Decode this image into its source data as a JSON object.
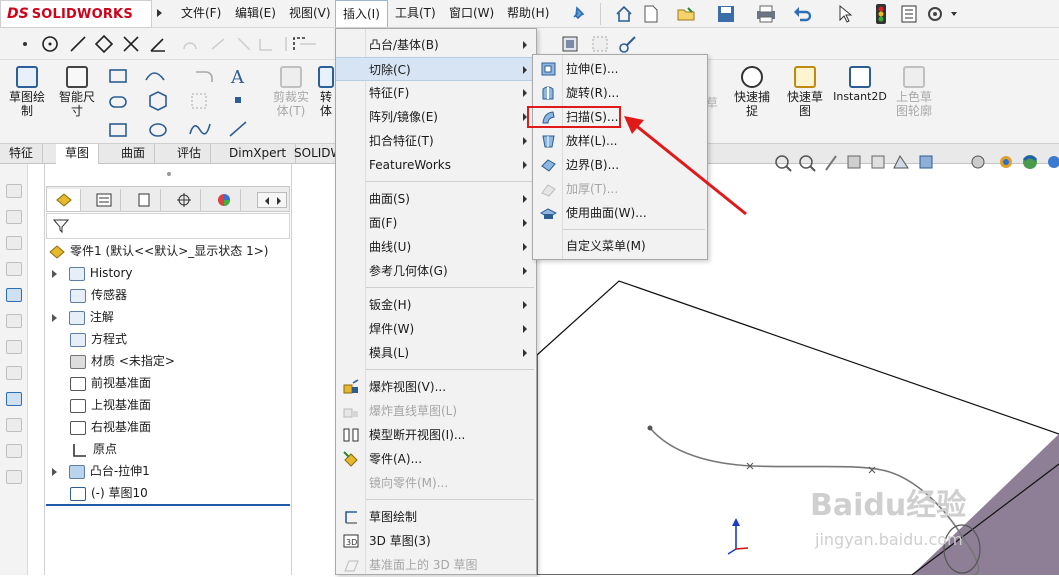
{
  "app": {
    "brand_ds": "DS",
    "brand_name": "SOLIDWORKS"
  },
  "menubar": [
    {
      "label": "文件(F)"
    },
    {
      "label": "编辑(E)"
    },
    {
      "label": "视图(V)"
    },
    {
      "label": "插入(I)"
    },
    {
      "label": "工具(T)"
    },
    {
      "label": "窗口(W)"
    },
    {
      "label": "帮助(H)"
    }
  ],
  "command_manager": {
    "buttons": [
      {
        "label1": "草图绘",
        "label2": "制"
      },
      {
        "label1": "智能尺",
        "label2": "寸"
      },
      {
        "label1": "剪裁实",
        "label2": "体(T)"
      },
      {
        "label1": "转",
        "label2": "体"
      },
      {
        "label1": "快速捕",
        "label2": "捉"
      },
      {
        "label1": "快速草",
        "label2": "图"
      },
      {
        "label1": "Instant2D",
        "label2": ""
      },
      {
        "label1": "上色草",
        "label2": "图轮廓"
      }
    ],
    "behind_label": "草"
  },
  "tabs": [
    "特征",
    "草图",
    "曲面",
    "评估",
    "DimXpert",
    "SOLIDW"
  ],
  "tree": {
    "root": "零件1 (默认<<默认>_显示状态 1>)",
    "items": [
      {
        "label": "History",
        "expandable": true
      },
      {
        "label": "传感器",
        "expandable": false
      },
      {
        "label": "注解",
        "expandable": true
      },
      {
        "label": "方程式",
        "expandable": false
      },
      {
        "label": "材质 <未指定>",
        "expandable": false
      },
      {
        "label": "前视基准面",
        "expandable": false
      },
      {
        "label": "上视基准面",
        "expandable": false
      },
      {
        "label": "右视基准面",
        "expandable": false
      },
      {
        "label": "原点",
        "expandable": false
      },
      {
        "label": "凸台-拉伸1",
        "expandable": true
      },
      {
        "label": "(-) 草图10",
        "expandable": false
      }
    ]
  },
  "insert_menu": {
    "items": [
      {
        "label": "凸台/基体(B)",
        "submenu": true
      },
      {
        "label": "切除(C)",
        "submenu": true,
        "highlighted": true
      },
      {
        "label": "特征(F)",
        "submenu": true
      },
      {
        "label": "阵列/镜像(E)",
        "submenu": true
      },
      {
        "label": "扣合特征(T)",
        "submenu": true
      },
      {
        "label": "FeatureWorks",
        "submenu": true
      },
      {
        "label": "曲面(S)",
        "submenu": true
      },
      {
        "label": "面(F)",
        "submenu": true
      },
      {
        "label": "曲线(U)",
        "submenu": true
      },
      {
        "label": "参考几何体(G)",
        "submenu": true
      },
      {
        "label": "钣金(H)",
        "submenu": true
      },
      {
        "label": "焊件(W)",
        "submenu": true
      },
      {
        "label": "模具(L)",
        "submenu": true
      },
      {
        "label": "爆炸视图(V)...",
        "submenu": false
      },
      {
        "label": "爆炸直线草图(L)",
        "submenu": false,
        "disabled": true
      },
      {
        "label": "模型断开视图(I)...",
        "submenu": false
      },
      {
        "label": "零件(A)...",
        "submenu": false
      },
      {
        "label": "镜向零件(M)...",
        "submenu": false,
        "disabled": true
      },
      {
        "label": "草图绘制",
        "submenu": false
      },
      {
        "label": "3D 草图(3)",
        "submenu": false
      },
      {
        "label": "基准面上的 3D 草图",
        "submenu": false,
        "disabled": true
      }
    ]
  },
  "cut_submenu": {
    "items": [
      {
        "label": "拉伸(E)..."
      },
      {
        "label": "旋转(R)..."
      },
      {
        "label": "扫描(S)...",
        "annotated": true
      },
      {
        "label": "放样(L)..."
      },
      {
        "label": "边界(B)..."
      },
      {
        "label": "加厚(T)...",
        "disabled": true
      },
      {
        "label": "使用曲面(W)..."
      },
      {
        "label": "自定义菜单(M)"
      }
    ]
  },
  "watermark": {
    "line1": "Baidu经验",
    "line2": "jingyan.baidu.com"
  },
  "colors": {
    "accent_red": "#e01919",
    "menu_highlight": "#d6e4f3",
    "brand_red": "#d0021b",
    "plane_purple": "#8e7f96"
  }
}
